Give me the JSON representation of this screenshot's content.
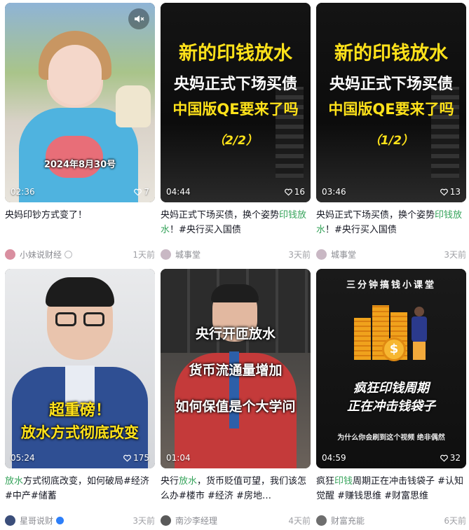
{
  "cards": [
    {
      "duration": "02:36",
      "likes": "7",
      "overlay": {
        "date": "2024年8月30号"
      },
      "title_parts": [
        "央妈印钞方式变了！"
      ],
      "author": "小妹说财经",
      "ago": "1天前"
    },
    {
      "duration": "04:44",
      "likes": "16",
      "overlay": {
        "line1": "新的印钱放水",
        "line2": "央妈正式下场买债",
        "line3": "中国版QE要来了吗",
        "line4": "（2/2）"
      },
      "title_a": "央妈正式下场买债，换个姿势",
      "title_hl": "印钱放水",
      "title_b": "！#央行买入国债",
      "author": "城事堂",
      "ago": "3天前"
    },
    {
      "duration": "03:46",
      "likes": "13",
      "overlay": {
        "line1": "新的印钱放水",
        "line2": "央妈正式下场买债",
        "line3": "中国版QE要来了吗",
        "line4": "（1/2）"
      },
      "title_a": "央妈正式下场买债，换个姿势",
      "title_hl": "印钱放水",
      "title_b": "！#央行买入国债",
      "author": "城事堂",
      "ago": "3天前"
    },
    {
      "duration": "05:24",
      "likes": "175",
      "overlay": {
        "line1": "超重磅！",
        "line2": "放水方式彻底改变"
      },
      "title_hl": "放水",
      "title_b": "方式彻底改变，如何破局#经济#中产#储蓄",
      "author": "星哥说财",
      "ago": "3天前"
    },
    {
      "duration": "01:04",
      "likes": "",
      "overlay": {
        "line1": "央行开匝放水",
        "line2": "货币流通量增加",
        "line3": "如何保值是个大学问"
      },
      "title_a": "央行",
      "title_hl": "放水",
      "title_b": "，货币贬值可望，我们该怎么办#楼市 #经济 #房地…",
      "author": "南沙李经理",
      "ago": "4天前"
    },
    {
      "duration": "04:59",
      "likes": "32",
      "overlay": {
        "line1": "三分钟搞钱小课堂",
        "line2": "疯狂印钱周期",
        "line3": "正在冲击钱袋子",
        "line4": "为什么你会刷到这个视频  绝非偶然"
      },
      "title_a": "疯狂",
      "title_hl": "印钱",
      "title_b": "周期正在冲击钱袋子 #认知觉醒 #赚钱思维 #财富思维",
      "author": "财富充能",
      "ago": "6天前"
    }
  ]
}
